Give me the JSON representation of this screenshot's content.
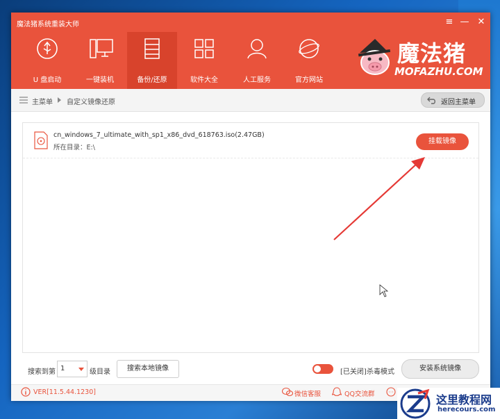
{
  "window": {
    "title": "魔法猪系统重装大师"
  },
  "controls": {
    "menu": "≡",
    "minimize": "—",
    "close": "✕"
  },
  "nav": {
    "items": [
      {
        "label": "U 盘启动",
        "icon": "usb-icon"
      },
      {
        "label": "一键装机",
        "icon": "monitor-icon"
      },
      {
        "label": "备份/还原",
        "icon": "backup-icon",
        "active": true
      },
      {
        "label": "软件大全",
        "icon": "grid-icon"
      },
      {
        "label": "人工服务",
        "icon": "person-icon"
      },
      {
        "label": "官方网站",
        "icon": "globe-icon"
      }
    ]
  },
  "logo": {
    "text": "魔法猪",
    "sub": "MOFAZHU.COM"
  },
  "breadcrumb": {
    "home": "主菜单",
    "current": "自定义镜像还原"
  },
  "back_button": {
    "label": "返回主菜单"
  },
  "file": {
    "name": "cn_windows_7_ultimate_with_sp1_x86_dvd_618763.iso(2.47GB)",
    "dir": "所在目录：E:\\",
    "mount_label": "挂载镜像"
  },
  "bottom": {
    "search_prefix": "搜索到第",
    "level_value": "1",
    "search_suffix": "级目录",
    "search_local_label": "搜索本地镜像",
    "antivirus_state": "[已关闭]",
    "antivirus_label": "杀毒模式",
    "install_label": "安装系统镜像"
  },
  "status": {
    "version": "VER[11.5.44.1230]",
    "wechat": "微信客服",
    "qq": "QQ交流群"
  },
  "watermark": {
    "text": "这里教程网",
    "sub": "herecours.com"
  },
  "colors": {
    "brand": "#e9533c",
    "brand_dark": "#d8432c"
  }
}
